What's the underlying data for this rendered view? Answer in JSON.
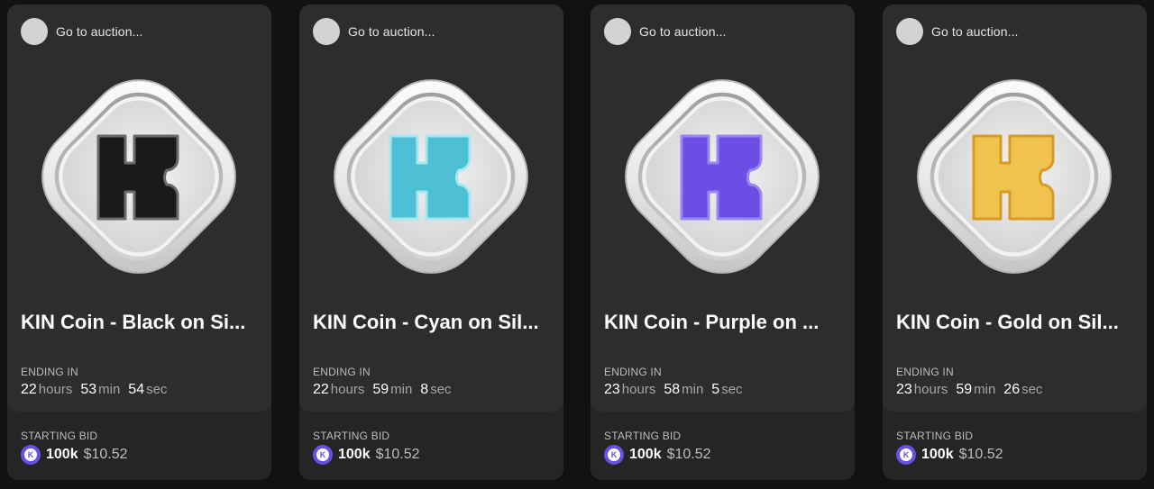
{
  "cards": [
    {
      "creator_label": "Go to auction...",
      "title": "KIN Coin - Black on Si...",
      "ending_label": "ENDING IN",
      "timer": {
        "hours": "22",
        "hours_unit": "hours",
        "min": "53",
        "min_unit": "min",
        "sec": "54",
        "sec_unit": "sec"
      },
      "bid_label": "STARTING BID",
      "bid_amount": "100k",
      "bid_usd": "$10.52",
      "coin_color": "#1a1a1a",
      "coin_edge": "#6a6a6a",
      "token_icon": "kin-token-icon",
      "token_glyph": "K"
    },
    {
      "creator_label": "Go to auction...",
      "title": "KIN Coin - Cyan on Sil...",
      "ending_label": "ENDING IN",
      "timer": {
        "hours": "22",
        "hours_unit": "hours",
        "min": "59",
        "min_unit": "min",
        "sec": "8",
        "sec_unit": "sec"
      },
      "bid_label": "STARTING BID",
      "bid_amount": "100k",
      "bid_usd": "$10.52",
      "coin_color": "#4ec0d6",
      "coin_edge": "#a7e7f2",
      "token_icon": "kin-token-icon",
      "token_glyph": "K"
    },
    {
      "creator_label": "Go to auction...",
      "title": "KIN Coin - Purple on ...",
      "ending_label": "ENDING IN",
      "timer": {
        "hours": "23",
        "hours_unit": "hours",
        "min": "58",
        "min_unit": "min",
        "sec": "5",
        "sec_unit": "sec"
      },
      "bid_label": "STARTING BID",
      "bid_amount": "100k",
      "bid_usd": "$10.52",
      "coin_color": "#6a4ee6",
      "coin_edge": "#9a86f2",
      "token_icon": "kin-token-icon",
      "token_glyph": "K"
    },
    {
      "creator_label": "Go to auction...",
      "title": "KIN Coin - Gold on Sil...",
      "ending_label": "ENDING IN",
      "timer": {
        "hours": "23",
        "hours_unit": "hours",
        "min": "59",
        "min_unit": "min",
        "sec": "26",
        "sec_unit": "sec"
      },
      "bid_label": "STARTING BID",
      "bid_amount": "100k",
      "bid_usd": "$10.52",
      "coin_color": "#f0c24f",
      "coin_edge": "#d99a1e",
      "token_icon": "kin-token-icon",
      "token_glyph": "K"
    }
  ]
}
